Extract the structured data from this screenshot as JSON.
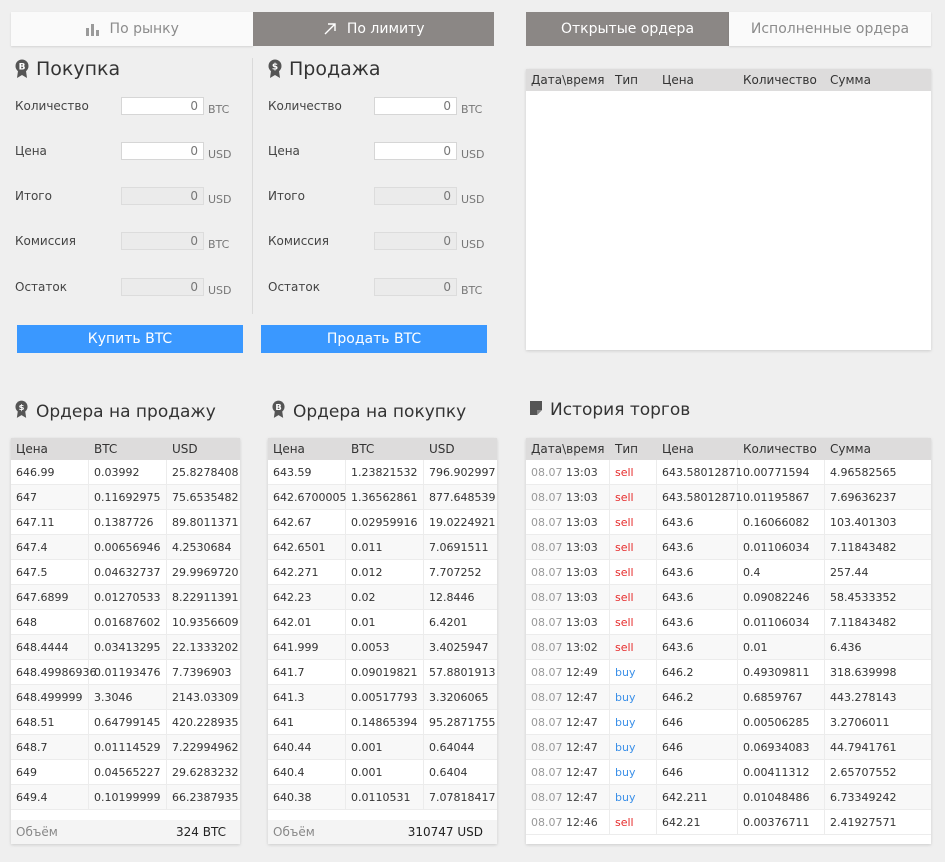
{
  "mode_tabs": {
    "market": "По рынку",
    "limit": "По лимиту"
  },
  "buy_form": {
    "title": "Покупка",
    "rows": [
      {
        "label": "Количество",
        "value": "0",
        "unit": "BTC"
      },
      {
        "label": "Цена",
        "value": "0",
        "unit": "USD"
      },
      {
        "label": "Итого",
        "value": "0",
        "unit": "USD"
      },
      {
        "label": "Комиссия",
        "value": "0",
        "unit": "BTC"
      },
      {
        "label": "Остаток",
        "value": "0",
        "unit": "USD"
      }
    ],
    "button": "Купить BTC"
  },
  "sell_form": {
    "title": "Продажа",
    "rows": [
      {
        "label": "Количество",
        "value": "0",
        "unit": "BTC"
      },
      {
        "label": "Цена",
        "value": "0",
        "unit": "USD"
      },
      {
        "label": "Итого",
        "value": "0",
        "unit": "USD"
      },
      {
        "label": "Комиссия",
        "value": "0",
        "unit": "USD"
      },
      {
        "label": "Остаток",
        "value": "0",
        "unit": "BTC"
      }
    ],
    "button": "Продать BTC"
  },
  "orders_tabs": {
    "open": "Открытые ордера",
    "filled": "Исполненные ордера"
  },
  "open_orders": {
    "headers": [
      "Дата\\время",
      "Тип",
      "Цена",
      "Количество",
      "Сумма"
    ]
  },
  "sell_orders": {
    "title": "Ордера на продажу",
    "headers": [
      "Цена",
      "BTC",
      "USD"
    ],
    "rows": [
      [
        "646.99",
        "0.03992",
        "25.8278408"
      ],
      [
        "647",
        "0.11692975",
        "75.6535482"
      ],
      [
        "647.11",
        "0.1387726",
        "89.8011371"
      ],
      [
        "647.4",
        "0.00656946",
        "4.2530684"
      ],
      [
        "647.5",
        "0.04632737",
        "29.9969720"
      ],
      [
        "647.6899",
        "0.01270533",
        "8.22911391"
      ],
      [
        "648",
        "0.01687602",
        "10.9356609"
      ],
      [
        "648.4444",
        "0.03413295",
        "22.1333202"
      ],
      [
        "648.49986936",
        "0.01193476",
        "7.7396903"
      ],
      [
        "648.499999",
        "3.3046",
        "2143.03309"
      ],
      [
        "648.51",
        "0.64799145",
        "420.228935"
      ],
      [
        "648.7",
        "0.01114529",
        "7.22994962"
      ],
      [
        "649",
        "0.04565227",
        "29.6283232"
      ],
      [
        "649.4",
        "0.10199999",
        "66.2387935"
      ]
    ],
    "footer_label": "Объём",
    "footer_value": "324 BTC"
  },
  "buy_orders": {
    "title": "Ордера на покупку",
    "headers": [
      "Цена",
      "BTC",
      "USD"
    ],
    "rows": [
      [
        "643.59",
        "1.23821532",
        "796.902997"
      ],
      [
        "642.6700005",
        "1.36562861",
        "877.648539"
      ],
      [
        "642.67",
        "0.02959916",
        "19.0224921"
      ],
      [
        "642.6501",
        "0.011",
        "7.0691511"
      ],
      [
        "642.271",
        "0.012",
        "7.707252"
      ],
      [
        "642.23",
        "0.02",
        "12.8446"
      ],
      [
        "642.01",
        "0.01",
        "6.4201"
      ],
      [
        "641.999",
        "0.0053",
        "3.4025947"
      ],
      [
        "641.7",
        "0.09019821",
        "57.8801913"
      ],
      [
        "641.3",
        "0.00517793",
        "3.3206065"
      ],
      [
        "641",
        "0.14865394",
        "95.2871755"
      ],
      [
        "640.44",
        "0.001",
        "0.64044"
      ],
      [
        "640.4",
        "0.001",
        "0.6404"
      ],
      [
        "640.38",
        "0.0110531",
        "7.07818417"
      ]
    ],
    "footer_label": "Объём",
    "footer_value": "310747 USD"
  },
  "trade_history": {
    "title": "История торгов",
    "headers": [
      "Дата\\время",
      "Тип",
      "Цена",
      "Количество",
      "Сумма"
    ],
    "rows": [
      [
        "08.07",
        "13:03",
        "sell",
        "643.58012871",
        "0.00771594",
        "4.96582565"
      ],
      [
        "08.07",
        "13:03",
        "sell",
        "643.58012871",
        "0.01195867",
        "7.69636237"
      ],
      [
        "08.07",
        "13:03",
        "sell",
        "643.6",
        "0.16066082",
        "103.401303"
      ],
      [
        "08.07",
        "13:03",
        "sell",
        "643.6",
        "0.01106034",
        "7.11843482"
      ],
      [
        "08.07",
        "13:03",
        "sell",
        "643.6",
        "0.4",
        "257.44"
      ],
      [
        "08.07",
        "13:03",
        "sell",
        "643.6",
        "0.09082246",
        "58.4533352"
      ],
      [
        "08.07",
        "13:03",
        "sell",
        "643.6",
        "0.01106034",
        "7.11843482"
      ],
      [
        "08.07",
        "13:02",
        "sell",
        "643.6",
        "0.01",
        "6.436"
      ],
      [
        "08.07",
        "12:49",
        "buy",
        "646.2",
        "0.49309811",
        "318.639998"
      ],
      [
        "08.07",
        "12:47",
        "buy",
        "646.2",
        "0.6859767",
        "443.278143"
      ],
      [
        "08.07",
        "12:47",
        "buy",
        "646",
        "0.00506285",
        "3.2706011"
      ],
      [
        "08.07",
        "12:47",
        "buy",
        "646",
        "0.06934083",
        "44.7941761"
      ],
      [
        "08.07",
        "12:47",
        "buy",
        "646",
        "0.00411312",
        "2.65707552"
      ],
      [
        "08.07",
        "12:47",
        "buy",
        "642.211",
        "0.01048486",
        "6.73349242"
      ],
      [
        "08.07",
        "12:46",
        "sell",
        "642.21",
        "0.00376711",
        "2.41927571"
      ]
    ]
  },
  "colors": {
    "accent": "#3a98ff",
    "active_tab": "#8b8785",
    "sell": "#e62b2b",
    "buy": "#3a8fe8"
  }
}
